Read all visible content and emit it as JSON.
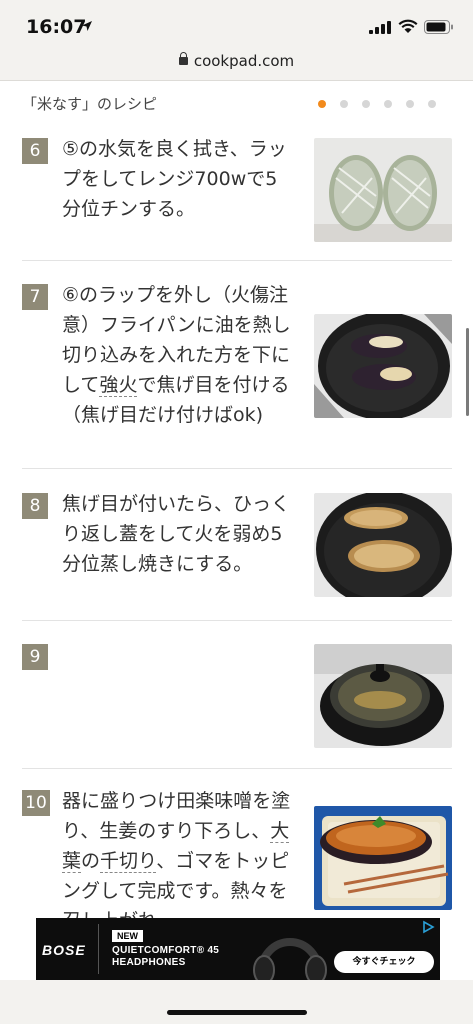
{
  "status": {
    "time": "16:07"
  },
  "browser": {
    "url": "cookpad.com"
  },
  "recipe": {
    "title": "「米なす」のレシピ"
  },
  "steps": [
    {
      "num": "6",
      "text_a": "⑤の水気を良く拭き、ラップをしてレンジ700wで5分位チンする。"
    },
    {
      "num": "7",
      "text_a": "⑥のラップを外し（火傷注意）フライパンに油を熱し切り込みを入れた方を下にして",
      "link": "強火",
      "text_b": "で焦げ目を付ける（焦げ目だけ付けばok)"
    },
    {
      "num": "8",
      "text_a": "焦げ目が付いたら、ひっくり返し蓋をして火を弱め5分位蒸し焼きにする。"
    },
    {
      "num": "9",
      "text_a": ""
    },
    {
      "num": "10",
      "text_a": "器に盛りつけ田楽味噌を塗り、生姜のすり下ろし、",
      "link1": "大葉",
      "mid": "の",
      "link2": "千切り",
      "text_b": "、ゴマをトッピングして完成です。熱々を召し上がれ。"
    }
  ],
  "ad": {
    "brand": "BOSE",
    "badge": "NEW",
    "product_line1": "QUIETCOMFORT® 45",
    "product_line2": "HEADPHONES",
    "cta": "今すぐチェック"
  },
  "colors": {
    "accent": "#f28a1c",
    "step_badge": "#8f8a77"
  }
}
